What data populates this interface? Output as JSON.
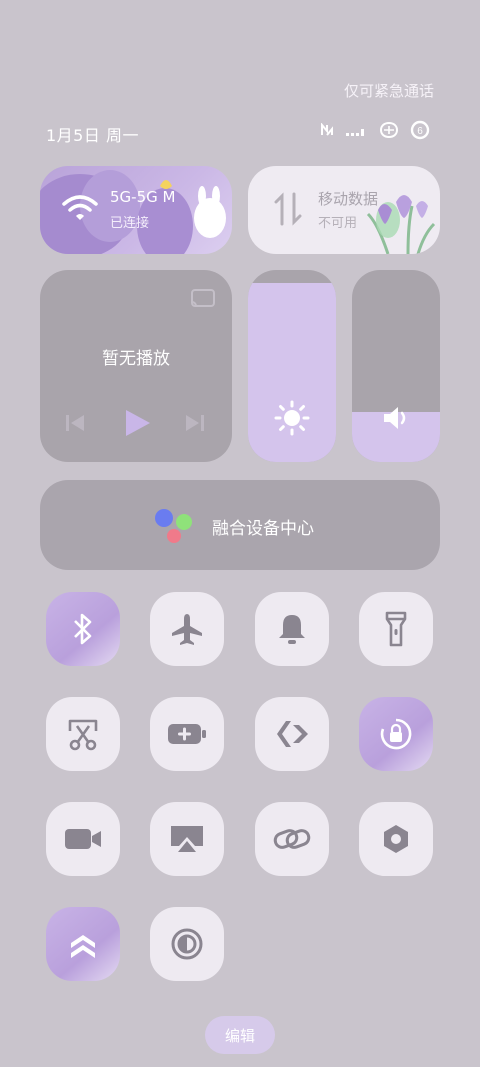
{
  "status": {
    "emergency_text": "仅可紧急通话",
    "date_text": "1月5日 周一",
    "icons": [
      "nfc-icon",
      "signal-icon",
      "vpn-icon",
      "battery-icon"
    ]
  },
  "wifi": {
    "label": "5G-5G  M",
    "status": "已连接",
    "icon": "wifi-icon",
    "state": "on"
  },
  "mobile_data": {
    "label": "移动数据",
    "status": "不可用",
    "icon": "data-arrows-icon",
    "state": "off"
  },
  "media": {
    "title": "暂无播放",
    "icons": [
      "cast-icon",
      "previous-icon",
      "play-icon",
      "next-icon"
    ]
  },
  "brightness": {
    "level_percent": 93,
    "icon": "sun-icon"
  },
  "volume": {
    "level_percent": 26,
    "icon": "speaker-icon"
  },
  "device_hub": {
    "label": "融合设备中心"
  },
  "toggles": [
    {
      "name": "bluetooth",
      "icon": "bluetooth-icon",
      "state": "on"
    },
    {
      "name": "airplane-mode",
      "icon": "airplane-icon",
      "state": "off"
    },
    {
      "name": "ring-mode",
      "icon": "bell-icon",
      "state": "off"
    },
    {
      "name": "flashlight",
      "icon": "flashlight-icon",
      "state": "off"
    },
    {
      "name": "screenshot",
      "icon": "scissors-icon",
      "state": "off"
    },
    {
      "name": "battery-saver",
      "icon": "battery-plus-icon",
      "state": "off"
    },
    {
      "name": "nearby-share",
      "icon": "share-diamond-icon",
      "state": "off"
    },
    {
      "name": "rotation-lock",
      "icon": "rotation-lock-icon",
      "state": "on"
    },
    {
      "name": "screen-record",
      "icon": "video-camera-icon",
      "state": "off"
    },
    {
      "name": "screen-cast",
      "icon": "airplay-icon",
      "state": "off"
    },
    {
      "name": "link",
      "icon": "link-icon",
      "state": "off"
    },
    {
      "name": "settings",
      "icon": "hexagon-settings-icon",
      "state": "off"
    },
    {
      "name": "performance-mode",
      "icon": "double-chevron-up-icon",
      "state": "on"
    },
    {
      "name": "dark-mode",
      "icon": "dark-mode-icon",
      "state": "off"
    }
  ],
  "edit_label": "编辑",
  "colors": {
    "accent": "#c9b6e8",
    "tile_dark": "#a9a4ab",
    "tile_light": "#eeeaf1",
    "icon_dark": "#8a8590"
  }
}
